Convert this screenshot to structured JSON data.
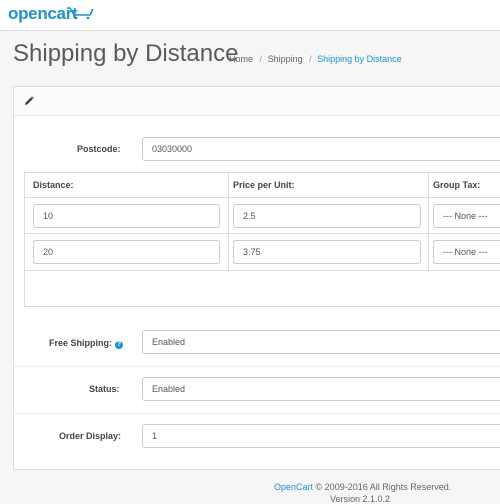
{
  "header": {
    "logo_text": "opencart",
    "brand_color": "#1e91cf"
  },
  "page": {
    "title": "Shipping by Distance"
  },
  "breadcrumb": {
    "home": "Home",
    "shipping": "Shipping",
    "current": "Shipping by Distance",
    "separator": "/"
  },
  "form": {
    "postcode": {
      "label": "Postcode:",
      "value": "03030000"
    },
    "rates_table": {
      "headers": [
        "Distance:",
        "Price per Unit:",
        "Group Tax:"
      ],
      "rows": [
        {
          "distance": "10",
          "price": "2.5",
          "group_tax": "--- None ---"
        },
        {
          "distance": "20",
          "price": "3.75",
          "group_tax": "--- None ---"
        }
      ]
    },
    "free_shipping": {
      "label": "Free Shipping:",
      "value": "Enabled",
      "help_icon": "question-circle-icon"
    },
    "status": {
      "label": "Status:",
      "value": "Enabled"
    },
    "order_display": {
      "label": "Order Display:",
      "value": "1"
    }
  },
  "footer": {
    "link": "OpenCart",
    "copyright": "© 2009-2016 All Rights Reserved.",
    "version": "Version 2.1.0.2"
  }
}
